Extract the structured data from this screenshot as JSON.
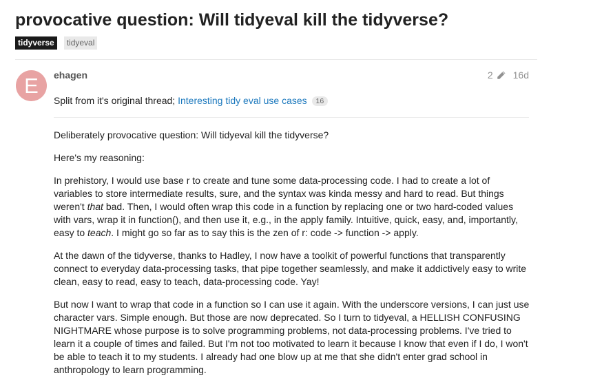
{
  "topic": {
    "title": "provocative question: Will tidyeval kill the tidyverse?",
    "tags": [
      "tidyverse",
      "tidyeval"
    ]
  },
  "post": {
    "avatar_letter": "E",
    "avatar_color": "#e8a3a3",
    "username": "ehagen",
    "edit_count": "2",
    "edit_icon": "pencil-icon",
    "age": "16d",
    "split_prefix": "Split from it's original thread; ",
    "split_link": "Interesting tidy eval use cases",
    "split_link_count": "16",
    "link_color": "#1b78bd",
    "p1": "Deliberately provocative question: Will tidyeval kill the tidyverse?",
    "p2": "Here's my reasoning:",
    "p3_a": "In prehistory, I would use base r to create and tune some data-processing code. I had to create a lot of variables to store intermediate results, sure, and the syntax was kinda messy and hard to read. But things weren't ",
    "p3_em1": "that",
    "p3_b": " bad. Then, I would often wrap this code in a function by replacing one or two hard-coded values with vars, wrap it in function(), and then use it, e.g., in the apply family. Intuitive, quick, easy, and, importantly, easy to ",
    "p3_em2": "teach",
    "p3_c": ". I might go so far as to say this is the zen of r: code -> function -> apply.",
    "p4": "At the dawn of the tidyverse, thanks to Hadley, I now have a toolkit of powerful functions that transparently connect to everyday data-processing tasks, that pipe together seamlessly, and make it addictively easy to write clean, easy to read, easy to teach, data-processing code. Yay!",
    "p5": "But now I want to wrap that code in a function so I can use it again. With the underscore versions, I can just use character vars. Simple enough. But those are now deprecated. So I turn to tidyeval, a HELLISH CONFUSING NIGHTMARE whose purpose is to solve programming problems, not data-processing problems. I've tried to learn it a couple of times and failed. But I'm not too motivated to learn it because I know that even if I do, I won't be able to teach it to my students. I already had one blow up at me that she didn't enter grad school in anthropology to learn programming."
  }
}
